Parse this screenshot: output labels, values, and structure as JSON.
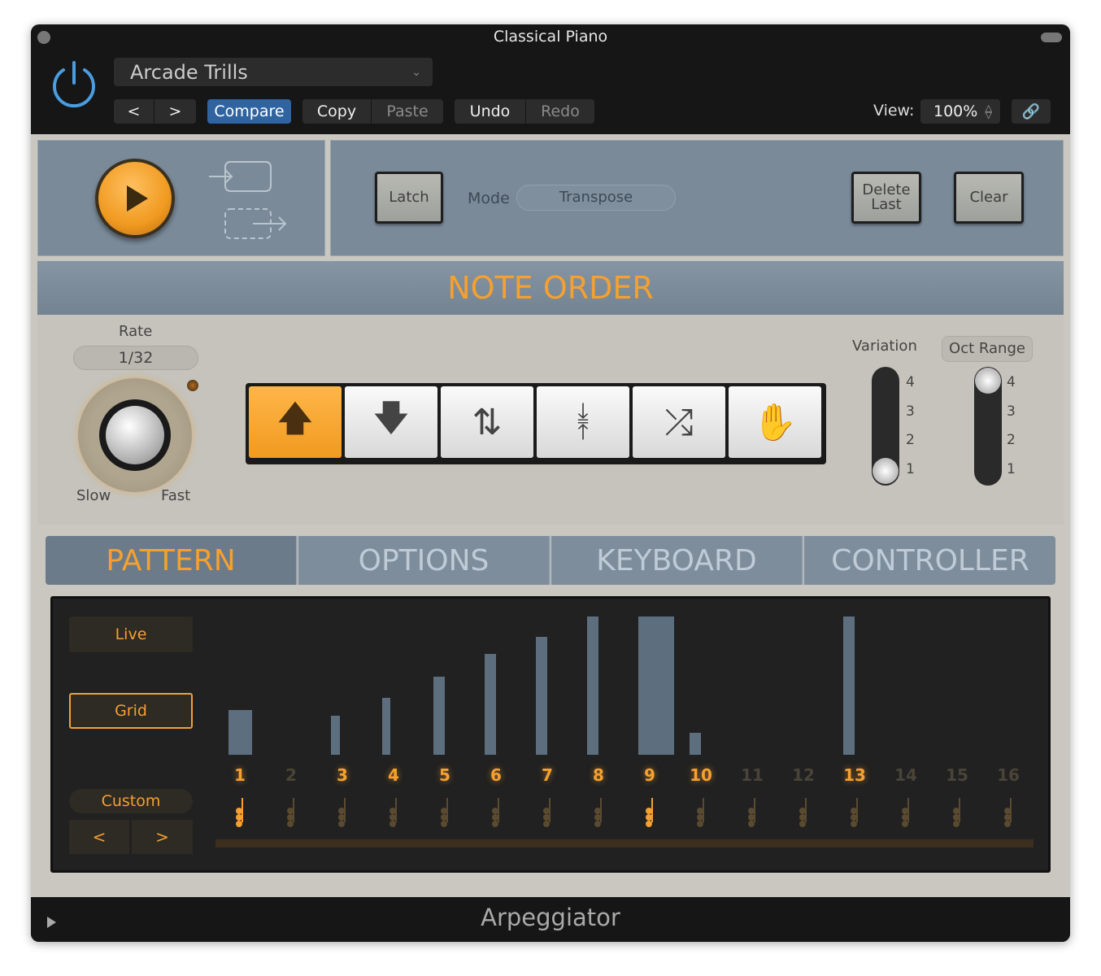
{
  "window": {
    "title": "Classical Piano"
  },
  "header": {
    "preset": "Arcade Trills",
    "compare": "Compare",
    "copy": "Copy",
    "paste": "Paste",
    "undo": "Undo",
    "redo": "Redo",
    "view_label": "View:",
    "view_value": "100%",
    "prev": "<",
    "next": ">"
  },
  "transport": {
    "latch": "Latch",
    "mode_label": "Mode",
    "mode_value": "Transpose",
    "delete_last": "Delete Last",
    "clear": "Clear"
  },
  "note_order": {
    "title": "NOTE ORDER",
    "rate_label": "Rate",
    "rate_value": "1/32",
    "slow": "Slow",
    "fast": "Fast",
    "variation_label": "Variation",
    "oct_range_label": "Oct Range",
    "variation_value": 1,
    "oct_range_value": 4,
    "scale": [
      "4",
      "3",
      "2",
      "1"
    ],
    "order_buttons": [
      "up",
      "down",
      "up-down",
      "outside-in",
      "random",
      "as-played"
    ],
    "selected_order": "up"
  },
  "tabs": [
    "PATTERN",
    "OPTIONS",
    "KEYBOARD",
    "CONTROLLER"
  ],
  "active_tab": "PATTERN",
  "pattern": {
    "live": "Live",
    "grid": "Grid",
    "custom": "Custom",
    "prev": "<",
    "next": ">",
    "steps": [
      {
        "n": "1",
        "active": true,
        "velocity": 41,
        "length": 0.46
      },
      {
        "n": "2",
        "active": false,
        "velocity": 0,
        "length": 0.2
      },
      {
        "n": "3",
        "active": true,
        "velocity": 36,
        "length": 0.18
      },
      {
        "n": "4",
        "active": true,
        "velocity": 52,
        "length": 0.16
      },
      {
        "n": "5",
        "active": true,
        "velocity": 72,
        "length": 0.22
      },
      {
        "n": "6",
        "active": true,
        "velocity": 93,
        "length": 0.22
      },
      {
        "n": "7",
        "active": true,
        "velocity": 108,
        "length": 0.22
      },
      {
        "n": "8",
        "active": true,
        "velocity": 127,
        "length": 0.22
      },
      {
        "n": "9",
        "active": true,
        "velocity": 127,
        "length": 0.7
      },
      {
        "n": "10",
        "active": true,
        "velocity": 20,
        "length": 0.22
      },
      {
        "n": "11",
        "active": false,
        "velocity": 0,
        "length": 0.2
      },
      {
        "n": "12",
        "active": false,
        "velocity": 0,
        "length": 0.2
      },
      {
        "n": "13",
        "active": true,
        "velocity": 127,
        "length": 0.22
      },
      {
        "n": "14",
        "active": false,
        "velocity": 0,
        "length": 0.2
      },
      {
        "n": "15",
        "active": false,
        "velocity": 0,
        "length": 0.2
      },
      {
        "n": "16",
        "active": false,
        "velocity": 0,
        "length": 0.2
      }
    ],
    "highlighted_notes": [
      "1",
      "9"
    ]
  },
  "footer": {
    "name": "Arpeggiator"
  },
  "colors": {
    "accent": "#f5a030",
    "power": "#4a9de0",
    "compare": "#2f64a0",
    "bar": "#5d6f7e"
  }
}
